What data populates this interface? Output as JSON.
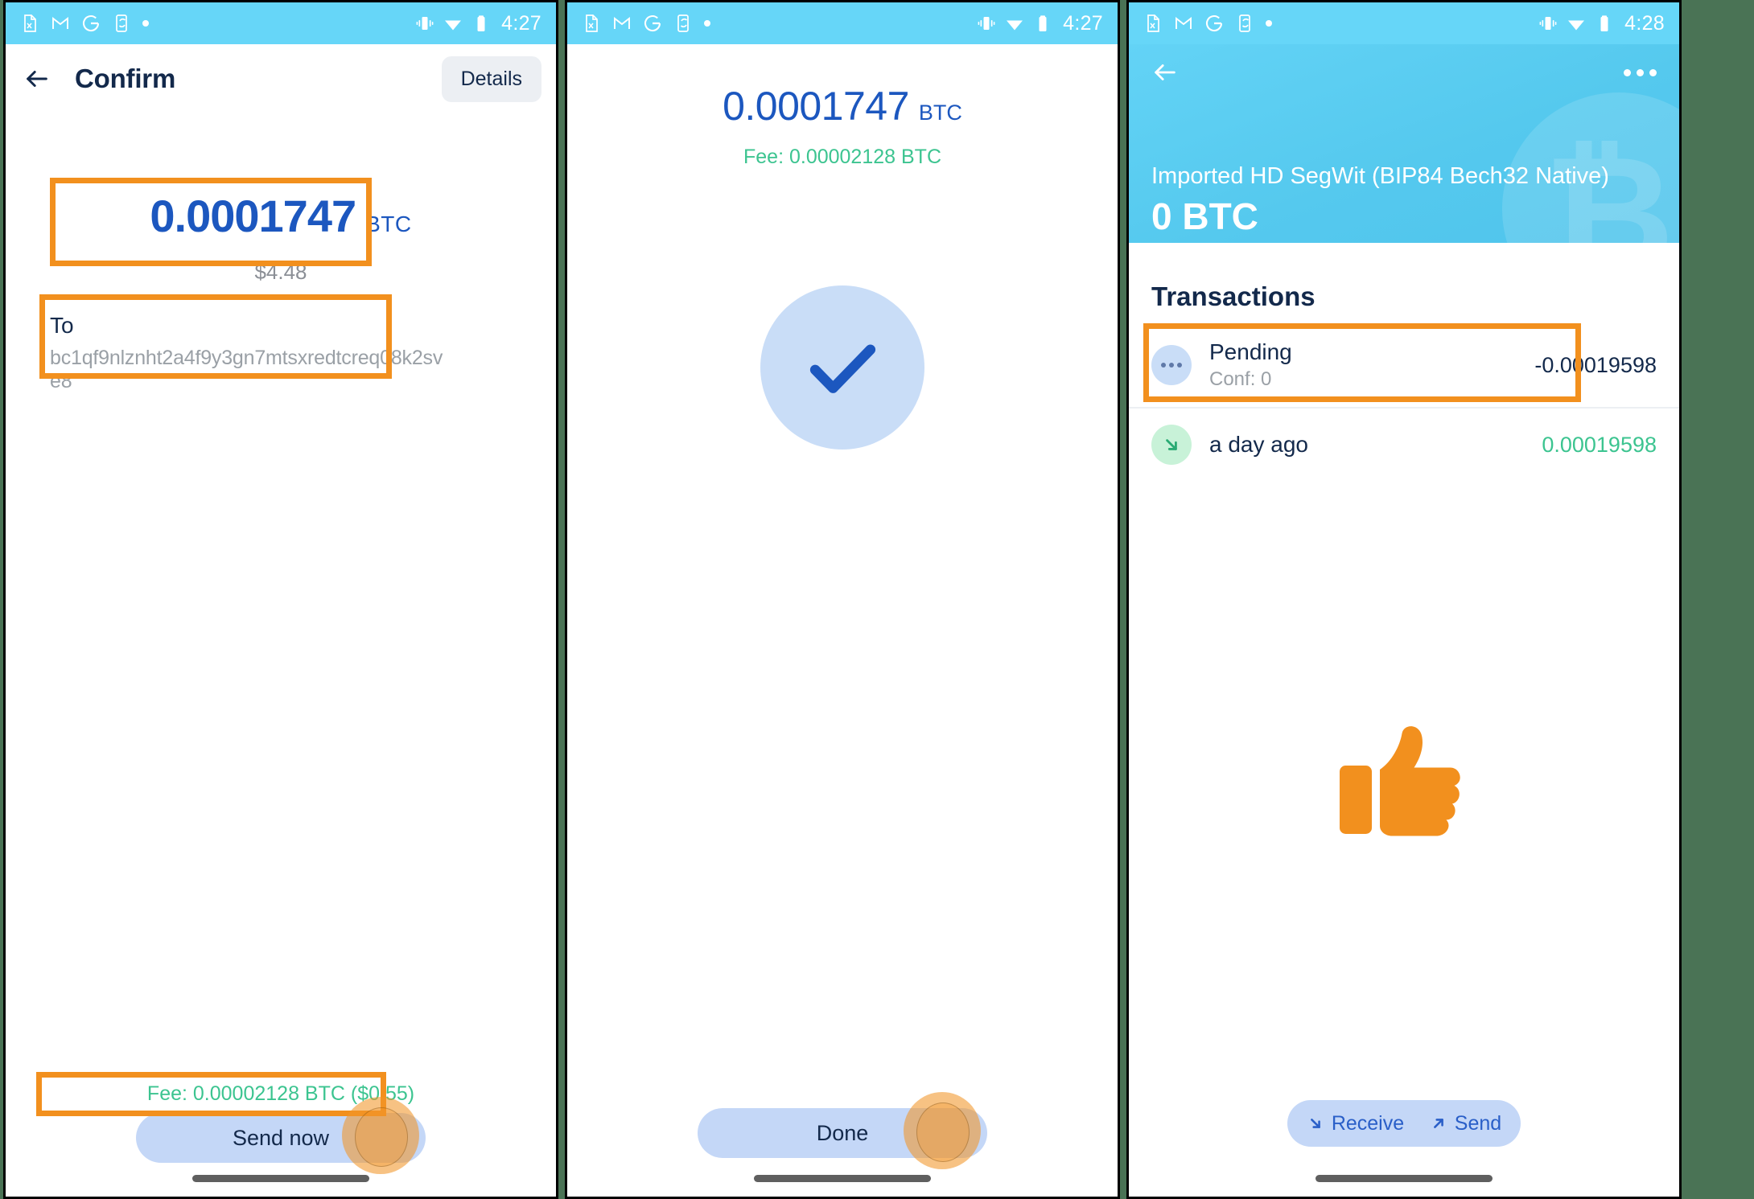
{
  "meta": {
    "accent_orange": "#f2901e",
    "brand_cyan": "#66d6f8",
    "brand_blue": "#1c57bf",
    "green": "#3cc490",
    "navy": "#13294b",
    "pill_blue": "#c4d7f7",
    "gutter_green": "#4a7355"
  },
  "status_bar": {
    "icons": [
      "spreadsheet-icon",
      "gmail-icon",
      "google-icon",
      "phone-sync-icon",
      "dot-icon"
    ],
    "right_icons": [
      "vibrate-icon",
      "wifi-icon",
      "battery-icon"
    ],
    "time_1": "4:27",
    "time_2": "4:27",
    "time_3": "4:28"
  },
  "panel1": {
    "appbar": {
      "back_icon": "back-arrow-icon",
      "title": "Confirm",
      "details_label": "Details"
    },
    "amount": {
      "value": "0.0001747",
      "unit": "BTC",
      "fiat": "$4.48"
    },
    "recipient": {
      "label": "To",
      "address": "bc1qf9nlznht2a4f9y3gn7mtsxredtcreq08k2sve8"
    },
    "fee_text": "Fee: 0.00002128 BTC ($0.55)",
    "send_button": "Send now"
  },
  "panel2": {
    "amount": {
      "value": "0.0001747",
      "unit": "BTC"
    },
    "fee_text": "Fee: 0.00002128 BTC",
    "success_icon": "check-icon",
    "done_button": "Done"
  },
  "panel3": {
    "header": {
      "back_icon": "back-arrow-icon",
      "menu_icon": "overflow-menu-icon",
      "wallet_name": "Imported HD SegWit (BIP84 Bech32 Native)",
      "balance": "0 BTC",
      "watermark_glyph": "₿"
    },
    "transactions_title": "Transactions",
    "transactions": [
      {
        "icon": "pending-dots-icon",
        "primary": "Pending",
        "secondary": "Conf: 0",
        "amount": "-0.00019598",
        "direction": "negative",
        "highlighted": true
      },
      {
        "icon": "arrow-down-right-icon",
        "primary": "a day ago",
        "secondary": "",
        "amount": "0.00019598",
        "direction": "positive",
        "highlighted": false
      }
    ],
    "empty_illustration": "thumbs-up-icon",
    "actions": {
      "receive_label": "Receive",
      "receive_icon": "arrow-down-right-icon",
      "send_label": "Send",
      "send_icon": "arrow-up-right-icon"
    }
  }
}
